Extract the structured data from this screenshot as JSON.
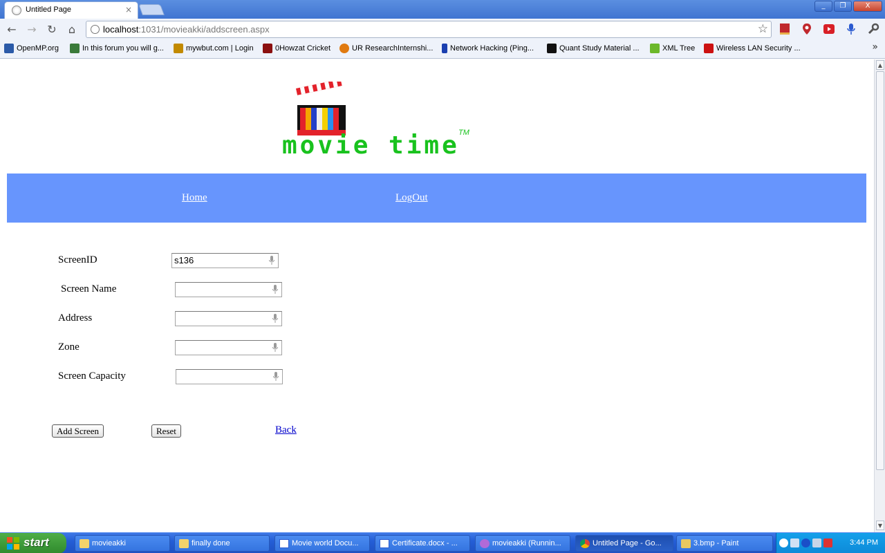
{
  "browser": {
    "tab_title": "Untitled Page",
    "tab_close": "×",
    "url_host": "localhost",
    "url_rest": ":1031/movieakki/addscreen.aspx",
    "window_buttons": {
      "minimize": "_",
      "restore": "❐",
      "close": "X"
    }
  },
  "bookmarks": [
    {
      "label": "OpenMP.org",
      "color": "#2b5aa8"
    },
    {
      "label": "In this forum you will g...",
      "color": "#3a7a3a"
    },
    {
      "label": "mywbut.com | Login",
      "color": "#c28a00"
    },
    {
      "label": "0Howzat Cricket",
      "color": "#8b1010"
    },
    {
      "label": "UR ResearchInternshi...",
      "color": "#e07a10"
    },
    {
      "label": "Network Hacking (Ping...",
      "color": "#1a3fb0"
    },
    {
      "label": "Quant Study Material ...",
      "color": "#111111"
    },
    {
      "label": "XML Tree",
      "color": "#6cb82a"
    },
    {
      "label": "Wireless LAN Security ...",
      "color": "#cc1111"
    }
  ],
  "bookmarks_more": "»",
  "logo": {
    "text": "movie time",
    "tm": "TM"
  },
  "nav": {
    "home": "Home",
    "logout": "LogOut"
  },
  "form": {
    "screen_id_label": "ScreenID",
    "screen_id_value": "s136",
    "screen_name_label": "Screen Name",
    "screen_name_value": "",
    "address_label": "Address",
    "address_value": "",
    "zone_label": "Zone",
    "zone_value": "",
    "capacity_label": "Screen Capacity",
    "capacity_value": ""
  },
  "actions": {
    "add": "Add Screen",
    "reset": "Reset",
    "back": "Back"
  },
  "taskbar": {
    "start": "start",
    "tasks": [
      "movieakki",
      "finally done",
      "Movie world Docu...",
      "Certificate.docx - ...",
      "movieakki (Runnin...",
      "Untitled Page - Go...",
      "3.bmp - Paint"
    ],
    "clock": "3:44 PM"
  },
  "colors": {
    "nav_band": "#6795fd",
    "logo_green": "#19c21e",
    "link_blue": "#0000cc"
  }
}
